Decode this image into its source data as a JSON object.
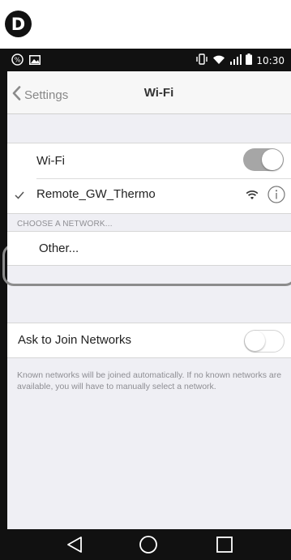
{
  "figure_label": "D",
  "status_bar": {
    "time": "10:30"
  },
  "nav": {
    "back_label": "Settings",
    "title": "Wi-Fi"
  },
  "wifi_toggle": {
    "label": "Wi-Fi",
    "state": "on"
  },
  "connected_network": {
    "name": "Remote_GW_Thermo"
  },
  "choose_section": {
    "header": "CHOOSE A NETWORK...",
    "other_label": "Other..."
  },
  "ask_to_join": {
    "label": "Ask to Join Networks",
    "state": "off",
    "note": "Known networks will be joined automatically. If no known networks are available, you will have to manually select a network."
  },
  "colors": {
    "highlight": "#8c8c8c",
    "toggle_on": "#a6a6a6",
    "group_bg": "#efeff4"
  },
  "icons": [
    "record-icon",
    "image-icon",
    "vibrate-icon",
    "wifi-icon",
    "signal-icon",
    "battery-icon",
    "chevron-left-icon",
    "checkmark-icon",
    "info-icon",
    "back-triangle-icon",
    "home-circle-icon",
    "recents-square-icon"
  ]
}
